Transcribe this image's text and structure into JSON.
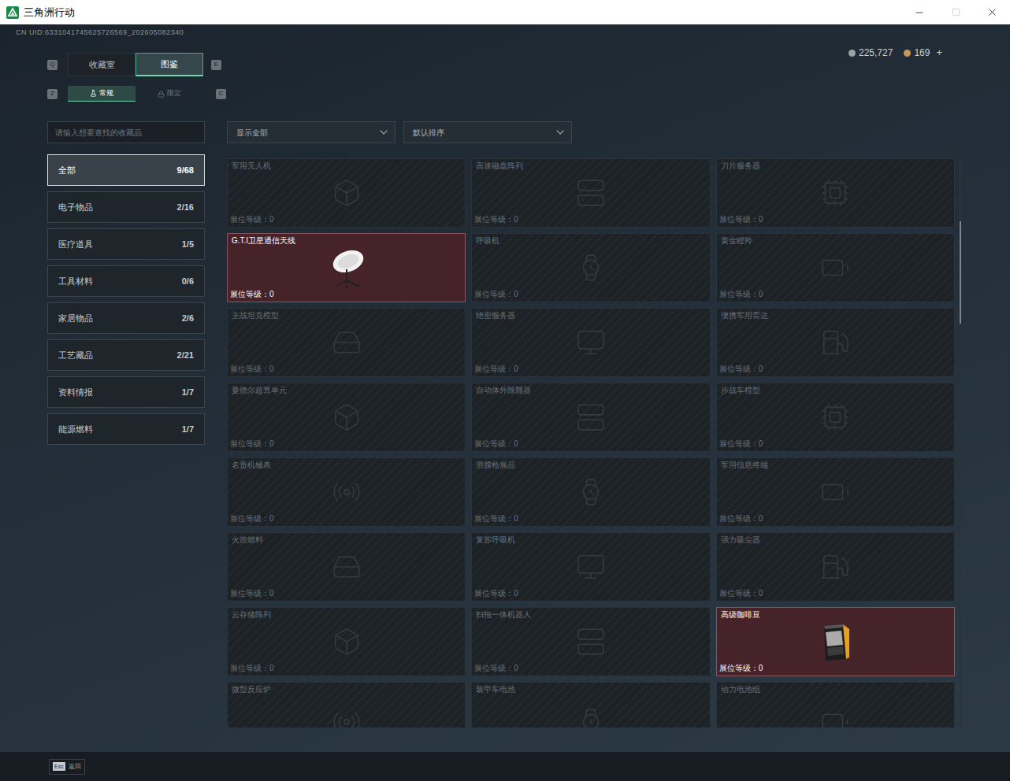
{
  "window": {
    "title": "三角洲行动"
  },
  "uid": "CN UID:6331041745625726569_202605082340",
  "tabs": [
    {
      "label": "收藏室",
      "selected": false
    },
    {
      "label": "图鉴",
      "selected": true
    }
  ],
  "tab_keys": [
    "Q",
    "E"
  ],
  "subtabs": [
    {
      "label": "常规",
      "selected": true
    },
    {
      "label": "限定",
      "selected": false
    }
  ],
  "subtab_keys": [
    "Z",
    "C"
  ],
  "currency": [
    {
      "value": "225,727",
      "color": "#9aa3a8"
    },
    {
      "value": "169",
      "color": "#c8965a"
    }
  ],
  "currency_add": "+",
  "search": {
    "placeholder": "请输入想要查找的收藏品"
  },
  "filters": [
    {
      "label": "显示全部"
    },
    {
      "label": "默认排序"
    }
  ],
  "categories": [
    {
      "label": "全部",
      "count": "9/68",
      "selected": true
    },
    {
      "label": "电子物品",
      "count": "2/16",
      "selected": false
    },
    {
      "label": "医疗道具",
      "count": "1/5",
      "selected": false
    },
    {
      "label": "工具材料",
      "count": "0/6",
      "selected": false
    },
    {
      "label": "家居物品",
      "count": "2/6",
      "selected": false
    },
    {
      "label": "工艺藏品",
      "count": "2/21",
      "selected": false
    },
    {
      "label": "资料情报",
      "count": "1/7",
      "selected": false
    },
    {
      "label": "能源燃料",
      "count": "1/7",
      "selected": false
    }
  ],
  "items": [
    {
      "name": "军用无人机",
      "booth": "展位等级：0",
      "collected": false
    },
    {
      "name": "高速磁盘阵列",
      "booth": "展位等级：0",
      "collected": false
    },
    {
      "name": "刀片服务器",
      "booth": "展位等级：0",
      "collected": false
    },
    {
      "name": "G.T.I卫星通信天线",
      "booth": "展位等级：0",
      "collected": true
    },
    {
      "name": "呼吸机",
      "booth": "展位等级：0",
      "collected": false
    },
    {
      "name": "黄金瞪羚",
      "booth": "展位等级：0",
      "collected": false
    },
    {
      "name": "主战坦克模型",
      "booth": "展位等级：0",
      "collected": false
    },
    {
      "name": "绝密服务器",
      "booth": "展位等级：0",
      "collected": false
    },
    {
      "name": "便携军用雷达",
      "booth": "展位等级：0",
      "collected": false
    },
    {
      "name": "曼德尔超算单元",
      "booth": "展位等级：0",
      "collected": false
    },
    {
      "name": "自动体外除颤器",
      "booth": "展位等级：0",
      "collected": false
    },
    {
      "name": "步战车模型",
      "booth": "展位等级：0",
      "collected": false
    },
    {
      "name": "名贵机械表",
      "booth": "展位等级：0",
      "collected": false
    },
    {
      "name": "滑膛枪展品",
      "booth": "展位等级：0",
      "collected": false
    },
    {
      "name": "军用信息终端",
      "booth": "展位等级：0",
      "collected": false
    },
    {
      "name": "火箭燃料",
      "booth": "展位等级：0",
      "collected": false
    },
    {
      "name": "复苏呼吸机",
      "booth": "展位等级：0",
      "collected": false
    },
    {
      "name": "强力吸尘器",
      "booth": "展位等级：0",
      "collected": false
    },
    {
      "name": "云存储阵列",
      "booth": "展位等级：0",
      "collected": false
    },
    {
      "name": "扫拖一体机器人",
      "booth": "展位等级：0",
      "collected": false
    },
    {
      "name": "高级咖啡豆",
      "booth": "展位等级：0",
      "collected": true
    },
    {
      "name": "微型反应炉",
      "collected": false
    },
    {
      "name": "装甲车电池",
      "collected": false
    },
    {
      "name": "动力电池组",
      "collected": false
    }
  ],
  "scrollbar": {
    "level": 0.11,
    "thumb": 0.18
  },
  "footer": {
    "key": "Esc",
    "label": "返回"
  }
}
